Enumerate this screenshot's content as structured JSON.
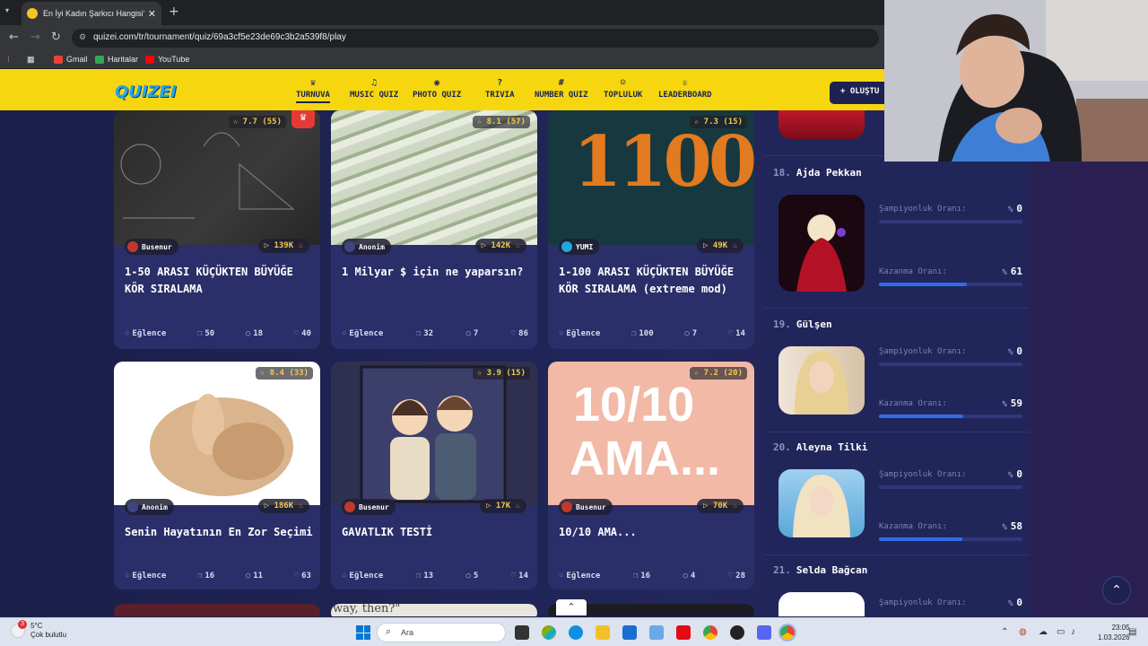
{
  "browser": {
    "tab_title": "En İyi Kadın Şarkıcı Hangisi? (H",
    "url": "quizei.com/tr/tournament/quiz/69a3cf5e23de69c3b2a539f8/play",
    "bookmarks": [
      "Gmail",
      "Haritalar",
      "YouTube"
    ]
  },
  "header": {
    "logo": "QUIZEI",
    "nav": [
      "TURNUVA",
      "MUSIC QUIZ",
      "PHOTO QUIZ",
      "TRIVIA",
      "NUMBER QUIZ",
      "TOPLULUK",
      "LEADERBOARD"
    ],
    "create_label": "+ OLUŞTU"
  },
  "cards": [
    {
      "rating": "☆ 7.7 (55)",
      "author": "Busenur",
      "plays": "139K",
      "title": "1-50 ARASI KÜÇÜKTEN BÜYÜĞE KÖR SIRALAMA",
      "category": "Eğlence",
      "questions": "50",
      "comments": "18",
      "likes": "40"
    },
    {
      "rating": "☆ 8.1 (57)",
      "author": "Anonim",
      "plays": "142K",
      "title": "1 Milyar $ için ne yaparsın?",
      "category": "Eğlence",
      "questions": "32",
      "comments": "7",
      "likes": "86"
    },
    {
      "rating": "☆ 7.3 (15)",
      "author": "YUMI",
      "plays": "49K",
      "title": "1-100 ARASI KÜÇÜKTEN BÜYÜĞE KÖR SIRALAMA (extreme mod)",
      "category": "Eğlence",
      "questions": "100",
      "comments": "7",
      "likes": "14"
    },
    {
      "rating": "☆ 8.4 (33)",
      "author": "Anonim",
      "plays": "186K",
      "title": "Senin Hayatının En Zor Seçimi",
      "category": "Eğlence",
      "questions": "16",
      "comments": "11",
      "likes": "63"
    },
    {
      "rating": "☆ 3.9 (15)",
      "author": "Busenur",
      "plays": "17K",
      "title": "GAVATLIK TESTİ",
      "category": "Eğlence",
      "questions": "13",
      "comments": "5",
      "likes": "14"
    },
    {
      "rating": "☆ 7.2 (20)",
      "author": "Busenur",
      "plays": "70K",
      "title": "10/10 AMA...",
      "category": "Eğlence",
      "questions": "16",
      "comments": "4",
      "likes": "28"
    }
  ],
  "thumb_text": {
    "card3": "1100",
    "card6_line1": "10/10",
    "card6_line2": "AMA...",
    "bottom_partial": "way, then?\""
  },
  "ranking": {
    "label_champ": "Şampiyonluk Oranı:",
    "label_win": "Kazanma Oranı:",
    "pct": "%",
    "items": [
      {
        "no": "18.",
        "name": "Ajda Pekkan",
        "champ": "0",
        "win": "61",
        "win_frac": 0.61
      },
      {
        "no": "19.",
        "name": "Gülşen",
        "champ": "0",
        "win": "59",
        "win_frac": 0.59
      },
      {
        "no": "20.",
        "name": "Aleyna Tilki",
        "champ": "0",
        "win": "58",
        "win_frac": 0.58
      },
      {
        "no": "21.",
        "name": "Selda Bağcan",
        "champ": "0"
      }
    ]
  },
  "taskbar": {
    "temp": "5°C",
    "weather": "Çok bulutlu",
    "badge": "3",
    "search": "Ara",
    "time": "23:05",
    "date": "1.03.2026"
  }
}
